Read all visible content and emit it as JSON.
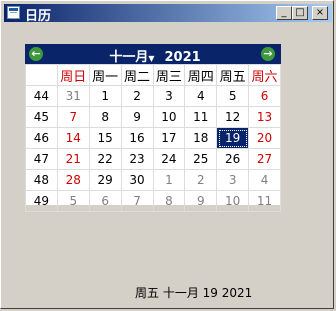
{
  "window": {
    "title": "日历"
  },
  "title_buttons": {
    "minimize": "_",
    "maximize": "□",
    "close": "×"
  },
  "calendar": {
    "month": "十一月",
    "year": "2021",
    "weekday_headers": [
      "周日",
      "周一",
      "周二",
      "周三",
      "周四",
      "周五",
      "周六"
    ],
    "weeks": [
      {
        "week": "44",
        "days": [
          "31",
          "1",
          "2",
          "3",
          "4",
          "5",
          "6"
        ]
      },
      {
        "week": "45",
        "days": [
          "7",
          "8",
          "9",
          "10",
          "11",
          "12",
          "13"
        ]
      },
      {
        "week": "46",
        "days": [
          "14",
          "15",
          "16",
          "17",
          "18",
          "19",
          "20"
        ]
      },
      {
        "week": "47",
        "days": [
          "21",
          "22",
          "23",
          "24",
          "25",
          "26",
          "27"
        ]
      },
      {
        "week": "48",
        "days": [
          "28",
          "29",
          "30",
          "1",
          "2",
          "3",
          "4"
        ]
      },
      {
        "week": "49",
        "days": [
          "5",
          "6",
          "7",
          "8",
          "9",
          "10",
          "11"
        ]
      }
    ],
    "selected_day": "19"
  },
  "footer": {
    "selected_date_text": "周五 十一月 19 2021"
  },
  "colors": {
    "title_bar": "#0a246a",
    "weekend": "#d00000",
    "other_month": "#808080",
    "selected_bg": "#0a246a"
  }
}
